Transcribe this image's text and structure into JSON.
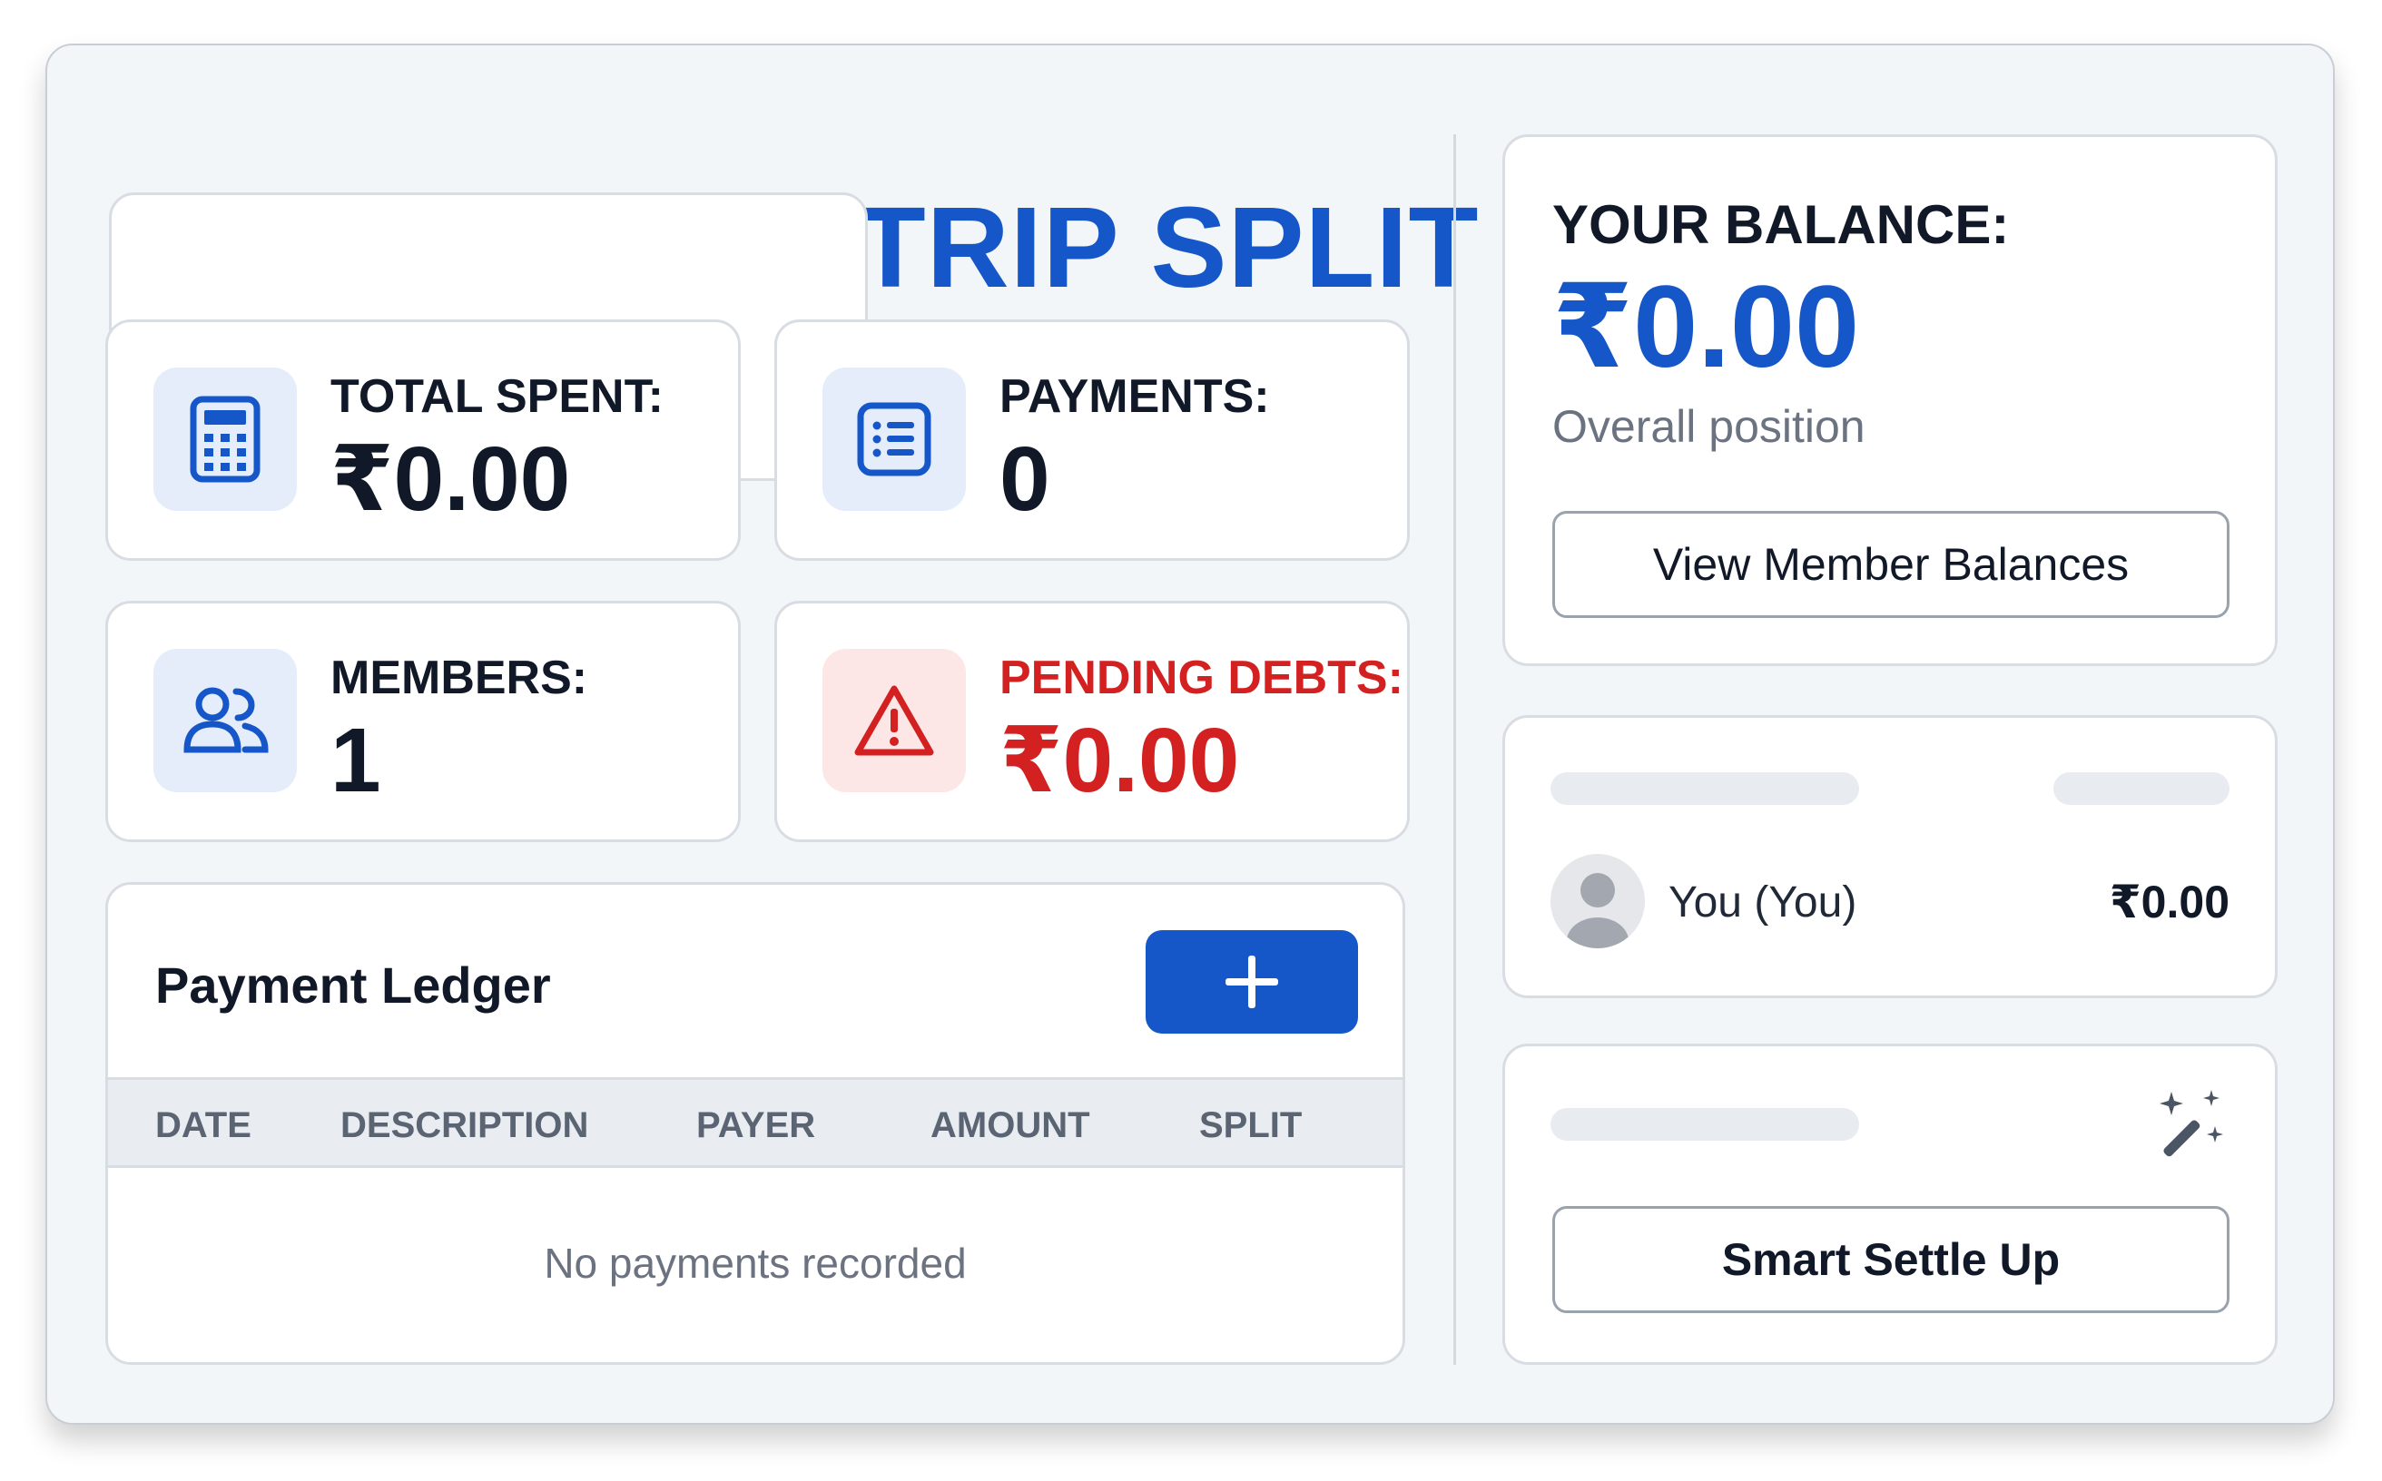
{
  "group": {
    "title": "GROUP: MY TRIP SPLIT"
  },
  "stats": {
    "total_spent": {
      "label": "TOTAL SPENT:",
      "value": "₹0.00",
      "icon": "calculator-icon"
    },
    "payments": {
      "label": "PAYMENTS:",
      "value": "0",
      "icon": "list-icon"
    },
    "members": {
      "label": "MEMBERS:",
      "value": "1",
      "icon": "users-icon"
    },
    "pending_debts": {
      "label": "PENDING DEBTS:",
      "value": "₹0.00",
      "icon": "warning-icon"
    }
  },
  "ledger": {
    "title": "Payment Ledger",
    "add_icon": "plus-icon",
    "columns": [
      "DATE",
      "DESCRIPTION",
      "PAYER",
      "AMOUNT",
      "SPLIT"
    ],
    "empty_text": "No payments recorded"
  },
  "balance": {
    "label": "YOUR BALANCE:",
    "value": "₹0.00",
    "subtitle": "Overall position",
    "button_label": "View Member Balances"
  },
  "members_list": {
    "items": [
      {
        "name": "You (You)",
        "amount": "₹0.00",
        "icon": "avatar-icon"
      }
    ]
  },
  "settle": {
    "icon": "magic-wand-icon",
    "button_label": "Smart Settle Up"
  },
  "colors": {
    "accent": "#1557c9",
    "danger": "#d32020",
    "background": "#f3f6f9"
  }
}
